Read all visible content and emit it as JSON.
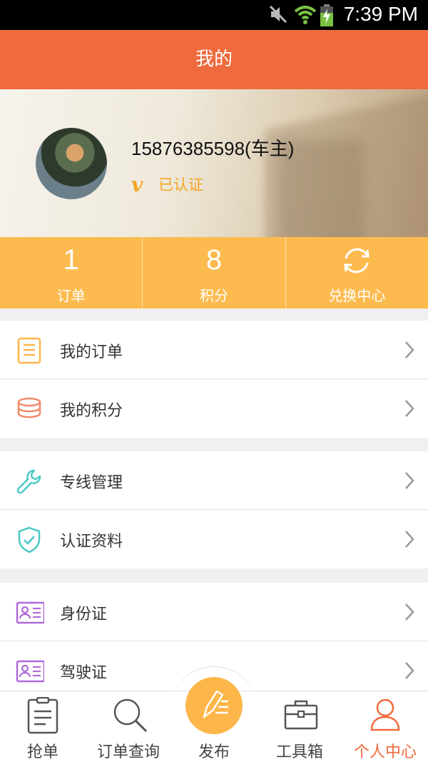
{
  "status_bar": {
    "time": "7:39 PM"
  },
  "header": {
    "title": "我的"
  },
  "profile": {
    "name": "15876385598(车主)",
    "verified_label": "已认证",
    "verified_mark": "v"
  },
  "stats": {
    "orders": {
      "value": "1",
      "label": "订单"
    },
    "points": {
      "value": "8",
      "label": "积分"
    },
    "exchange": {
      "label": "兑换中心"
    }
  },
  "menu": {
    "group1": [
      {
        "label": "我的订单",
        "icon": "document-icon"
      },
      {
        "label": "我的积分",
        "icon": "coins-icon"
      }
    ],
    "group2": [
      {
        "label": "专线管理",
        "icon": "wrench-icon"
      },
      {
        "label": "认证资料",
        "icon": "shield-check-icon"
      }
    ],
    "group3": [
      {
        "label": "身份证",
        "icon": "id-card-icon"
      },
      {
        "label": "驾驶证",
        "icon": "license-card-icon"
      }
    ]
  },
  "tabbar": {
    "tabs": [
      {
        "label": "抢单",
        "icon": "clipboard-icon"
      },
      {
        "label": "订单查询",
        "icon": "search-icon"
      },
      {
        "label": "发布",
        "icon": "pencil-icon"
      },
      {
        "label": "工具箱",
        "icon": "toolbox-icon"
      },
      {
        "label": "个人中心",
        "icon": "person-icon"
      }
    ],
    "active_index": 4
  },
  "colors": {
    "header": "#ef6a3d",
    "stats_bar": "#fdbb4f",
    "accent_orange": "#f5a623",
    "active_tab": "#ef6a3d",
    "icon_teal": "#4dc9c6",
    "icon_purple": "#b06ad9",
    "icon_coral": "#f08a6a"
  }
}
